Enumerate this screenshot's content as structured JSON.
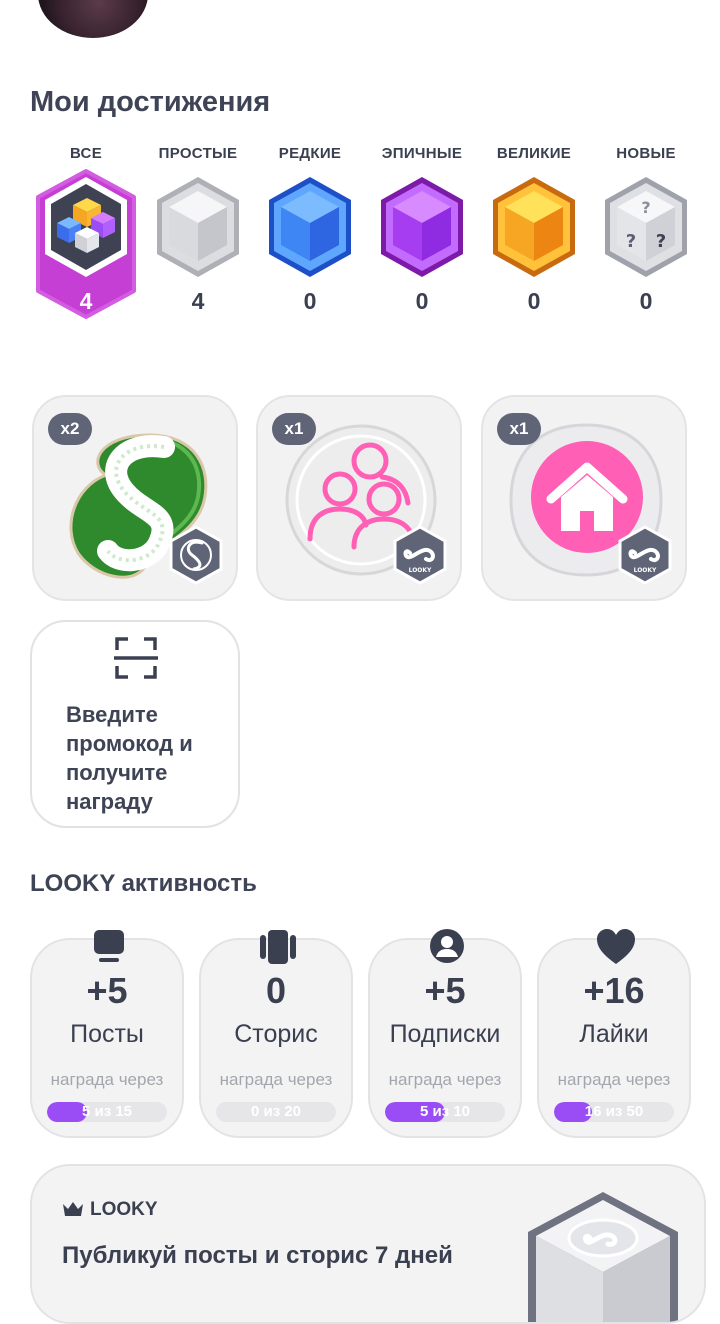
{
  "achievements": {
    "title": "Мои достижения",
    "categories": [
      {
        "label": "ВСЕ",
        "count": "4",
        "active": true
      },
      {
        "label": "ПРОСТЫЕ",
        "count": "4"
      },
      {
        "label": "РЕДКИЕ",
        "count": "0"
      },
      {
        "label": "ЭПИЧНЫЕ",
        "count": "0"
      },
      {
        "label": "ВЕЛИКИЕ",
        "count": "0"
      },
      {
        "label": "НОВЫЕ",
        "count": "0"
      }
    ]
  },
  "badges": [
    {
      "multiplier": "x2",
      "name": "leaf-s-badge"
    },
    {
      "multiplier": "x1",
      "name": "friends-badge"
    },
    {
      "multiplier": "x1",
      "name": "home-badge"
    }
  ],
  "promo": {
    "text": "Введите промокод и получите награду"
  },
  "activity": {
    "title": "LOOKY активность",
    "items": [
      {
        "icon": "post-icon",
        "value": "+5",
        "label": "Посты",
        "sub": "награда через",
        "progress_text": "5 из 15",
        "progress": 0.333
      },
      {
        "icon": "stories-icon",
        "value": "0",
        "label": "Сторис",
        "sub": "награда через",
        "progress_text": "0 из 20",
        "progress": 0
      },
      {
        "icon": "user-icon",
        "value": "+5",
        "label": "Подписки",
        "sub": "награда через",
        "progress_text": "5 из 10",
        "progress": 0.5
      },
      {
        "icon": "heart-icon",
        "value": "+16",
        "label": "Лайки",
        "sub": "награда через",
        "progress_text": "16 из 50",
        "progress": 0.32
      }
    ]
  },
  "banner": {
    "brand": "LOOKY",
    "title": "Публикуй посты и сторис 7 дней"
  },
  "colors": {
    "accent": "#9b4df5",
    "active_tab": "#c63fd4",
    "text": "#3b4050"
  }
}
